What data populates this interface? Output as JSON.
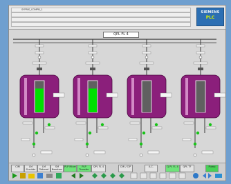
{
  "alarm": {
    "message_1": "SYPRIS_COMPB_1",
    "rows": 4
  },
  "brand": {
    "name": "SIEMENS",
    "product": "PLC"
  },
  "plant": {
    "title": "QPL FL 4",
    "unit_count": 4
  },
  "footer": {
    "buttons": [
      {
        "label": "CIM",
        "state": "normal"
      },
      {
        "label": "LM Scrubbr",
        "state": "normal"
      },
      {
        "label": "LM Tailored",
        "state": "normal"
      },
      {
        "label": "SM Boosters",
        "state": "normal"
      },
      {
        "label": "PLP Mixer",
        "state": "green"
      },
      {
        "label": "PLP Transfer",
        "state": "green"
      },
      {
        "label": "QPL FL 4",
        "state": "normal"
      },
      {
        "label": "CMI / CIP",
        "state": "normal"
      },
      {
        "label": "A.C.",
        "state": "normal"
      },
      {
        "label": "Q PL FL 4",
        "state": "green"
      },
      {
        "label": "QPL TF",
        "state": "normal"
      },
      {
        "label": "Pump",
        "state": "green2"
      }
    ]
  },
  "colors": {
    "vessel": "#8b1f7b",
    "level": "#00e000",
    "empty": "#606060"
  },
  "units": [
    {
      "level_pct": 75,
      "filled": true
    },
    {
      "level_pct": 75,
      "filled": true
    },
    {
      "level_pct": 80,
      "filled": false
    },
    {
      "level_pct": 80,
      "filled": false
    }
  ]
}
